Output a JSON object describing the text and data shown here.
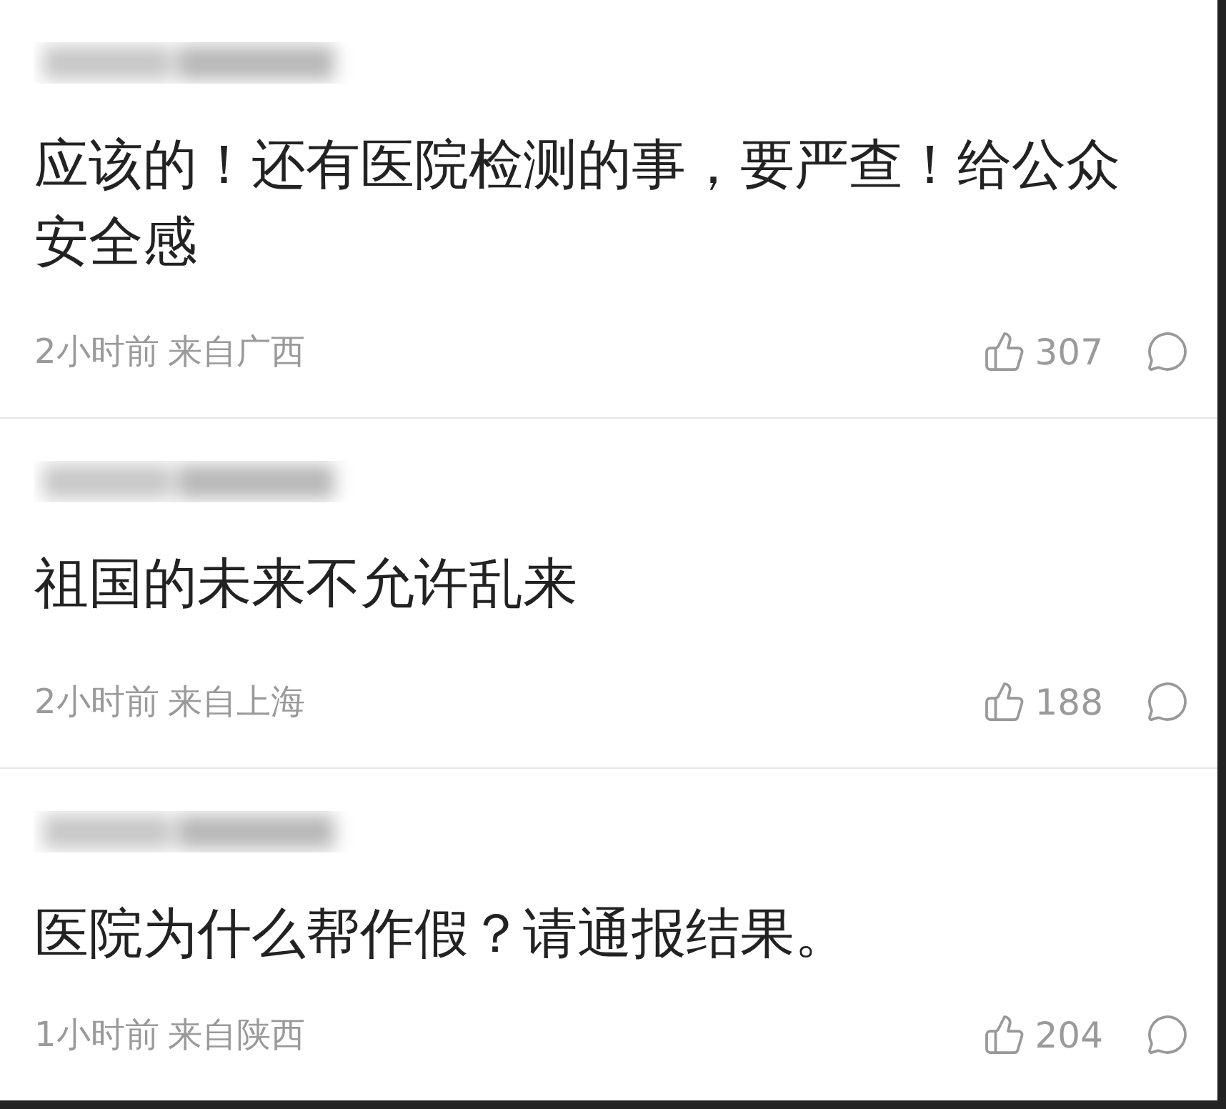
{
  "comments": [
    {
      "text": "应该的！还有医院检测的事，要严查！给公众安全感",
      "time": "2小时前",
      "location": "来自广西",
      "likes": "307"
    },
    {
      "text": "祖国的未来不允许乱来",
      "time": "2小时前",
      "location": "来自上海",
      "likes": "188"
    },
    {
      "text": "医院为什么帮作假？请通报结果。",
      "time": "1小时前",
      "location": "来自陕西",
      "likes": "204"
    }
  ]
}
